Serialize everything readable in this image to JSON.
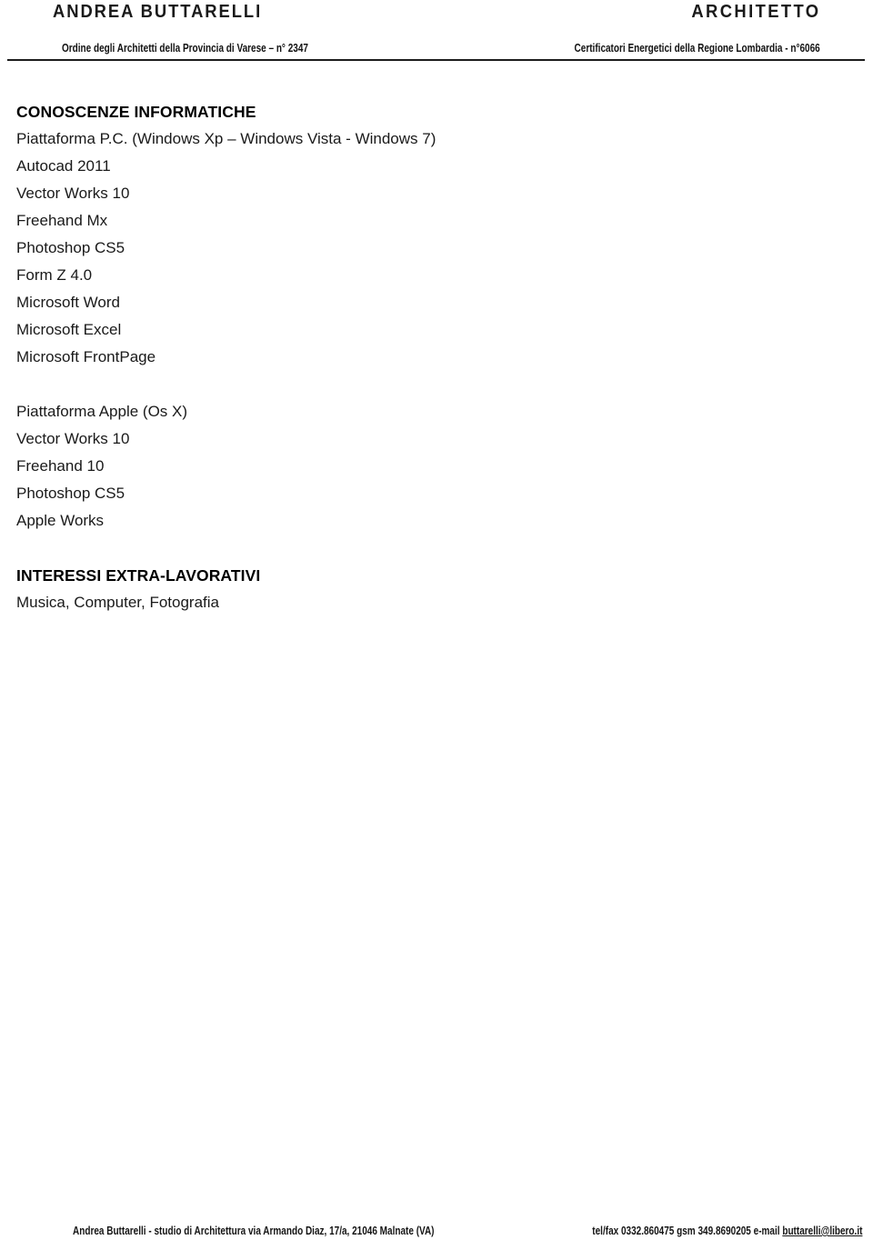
{
  "letterhead": {
    "name": "ANDREA BUTTARELLI",
    "role": "ARCHITETTO",
    "registration_left": "Ordine degli Architetti della Provincia di Varese – n° 2347",
    "registration_right": "Certificatori Energetici della Regione Lombardia - n°6066"
  },
  "sections": {
    "informatiche": {
      "heading": "CONOSCENZE INFORMATICHE",
      "pc_platform": "Piattaforma P.C. (Windows Xp – Windows Vista - Windows 7)",
      "pc_items": [
        "Autocad 2011",
        "Vector Works 10",
        "Freehand Mx",
        "Photoshop CS5",
        "Form Z 4.0",
        "Microsoft Word",
        "Microsoft Excel",
        "Microsoft FrontPage"
      ],
      "apple_platform": "Piattaforma Apple (Os X)",
      "apple_items": [
        "Vector Works 10",
        "Freehand 10",
        "Photoshop CS5",
        "Apple Works"
      ]
    },
    "interessi": {
      "heading": "INTERESSI EXTRA-LAVORATIVI",
      "items": [
        "Musica, Computer, Fotografia"
      ]
    }
  },
  "footer": {
    "address": "Andrea Buttarelli  -  studio di Architettura via Armando Diaz, 17/a, 21046 Malnate (VA)",
    "contacts_prefix": "tel/fax 0332.860475 gsm  349.8690205 e-mail ",
    "email": "buttarelli@libero.it"
  }
}
